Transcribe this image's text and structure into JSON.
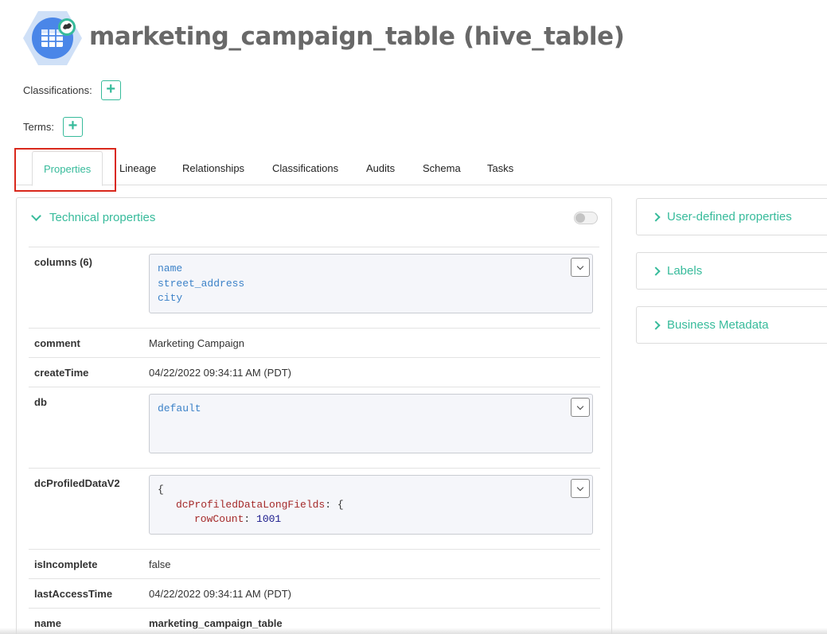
{
  "entity": {
    "title": "marketing_campaign_table (hive_table)",
    "icon": "hive-table-icon"
  },
  "classifications": {
    "label": "Classifications:",
    "add_label": "+"
  },
  "terms": {
    "label": "Terms:",
    "add_label": "+"
  },
  "tabs": [
    {
      "label": "Properties",
      "active": true
    },
    {
      "label": "Lineage"
    },
    {
      "label": "Relationships"
    },
    {
      "label": "Classifications"
    },
    {
      "label": "Audits"
    },
    {
      "label": "Schema"
    },
    {
      "label": "Tasks"
    }
  ],
  "technical": {
    "title": "Technical properties",
    "toggle_on": false,
    "properties": {
      "columns": {
        "name": "columns (6)",
        "values": [
          "name",
          "street_address",
          "city"
        ]
      },
      "comment": {
        "name": "comment",
        "value": "Marketing Campaign"
      },
      "createTime": {
        "name": "createTime",
        "value": "04/22/2022 09:34:11 AM (PDT)"
      },
      "db": {
        "name": "db",
        "value": "default"
      },
      "dcProfiledDataV2": {
        "name": "dcProfiledDataV2",
        "open": "{",
        "key1": "dcProfiledDataLongFields",
        "colon1": ": {",
        "key2": "rowCount",
        "colon2": ": ",
        "num": "1001"
      },
      "isIncomplete": {
        "name": "isIncomplete",
        "value": "false"
      },
      "lastAccessTime": {
        "name": "lastAccessTime",
        "value": "04/22/2022 09:34:11 AM (PDT)"
      },
      "name": {
        "name": "name",
        "value": "marketing_campaign_table"
      }
    }
  },
  "sidebar": {
    "cards": [
      {
        "label": "User-defined properties"
      },
      {
        "label": "Labels"
      },
      {
        "label": "Business Metadata"
      }
    ]
  },
  "colors": {
    "accent": "#37bb9b",
    "highlight": "#d9281c"
  }
}
